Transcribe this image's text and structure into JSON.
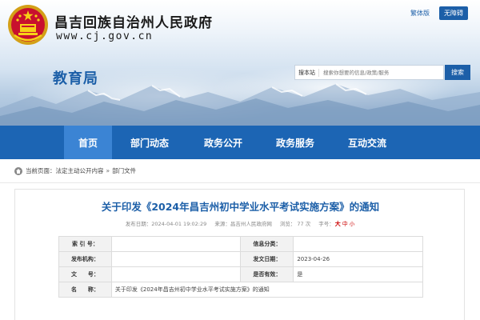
{
  "header": {
    "gov_title": "昌吉回族自治州人民政府",
    "gov_url": "www.cj.gov.cn",
    "department": "教育局",
    "lang_label": "繁体版",
    "accessibility_label": "无障碍",
    "emblem_icon": "national-emblem-icon"
  },
  "search": {
    "label": "搜本站",
    "placeholder": "搜索你想要的信息/政策/服务",
    "button_label": "搜索"
  },
  "colors": {
    "primary": "#1c65b4",
    "nav_active": "#3b84d4",
    "title_blue": "#1c5fa8",
    "accent_red": "#cc0000"
  },
  "nav": {
    "items": [
      {
        "label": "首页",
        "active": true
      },
      {
        "label": "部门动态"
      },
      {
        "label": "政务公开"
      },
      {
        "label": "政务服务"
      },
      {
        "label": "互动交流"
      }
    ]
  },
  "breadcrumb": {
    "icon": "home-icon",
    "prefix": "当前页面：",
    "items": [
      "法定主动公开内容",
      "部门文件"
    ],
    "separator": "»"
  },
  "article": {
    "title": "关于印发《2024年昌吉州初中学业水平考试实施方案》的通知",
    "published_label": "发布日期：",
    "published_value": "2024-04-01 19:02:29",
    "source_label": "来源：",
    "source_value": "昌吉州人民政府网",
    "views_label": "浏览：",
    "views_value": "77",
    "views_unit": "次",
    "font_label": "字号：",
    "font_big": "大",
    "font_mid": "中",
    "font_small": "小"
  },
  "info_table": {
    "rows": [
      [
        {
          "label": "索 引 号：",
          "value": ""
        },
        {
          "label": "信息分类：",
          "value": ""
        }
      ],
      [
        {
          "label": "发布机构：",
          "value": ""
        },
        {
          "label": "发文日期：",
          "value": "2023-04-26"
        }
      ],
      [
        {
          "label": "文　　号：",
          "value": ""
        },
        {
          "label": "是否有效：",
          "value": "是"
        }
      ]
    ],
    "name_label": "名　　称：",
    "name_value": "关于印发《2024年昌吉州初中学业水平考试实施方案》的通知"
  }
}
